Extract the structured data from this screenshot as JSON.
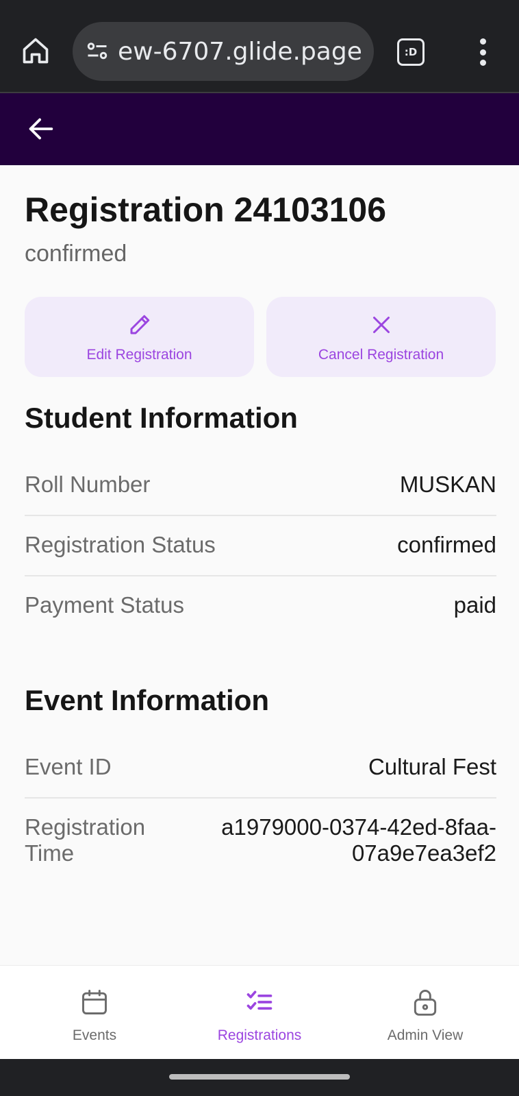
{
  "browser": {
    "url": "ew-6707.glide.page",
    "tab_label": ":D"
  },
  "page": {
    "title": "Registration 24103106",
    "status": "confirmed"
  },
  "actions": {
    "edit_label": "Edit Registration",
    "cancel_label": "Cancel Registration"
  },
  "student_section": {
    "title": "Student Information",
    "rows": [
      {
        "key": "Roll Number",
        "value": "MUSKAN"
      },
      {
        "key": "Registration Status",
        "value": "confirmed"
      },
      {
        "key": "Payment Status",
        "value": "paid"
      }
    ]
  },
  "event_section": {
    "title": "Event Information",
    "rows": [
      {
        "key": "Event ID",
        "value": "Cultural Fest"
      },
      {
        "key_line1": "Registration",
        "key_line2": "Time",
        "value_line1": "a1979000-0374-42ed-8faa-",
        "value_line2": "07a9e7ea3ef2"
      }
    ]
  },
  "nav": {
    "items": [
      {
        "label": "Events",
        "icon": "calendar-icon"
      },
      {
        "label": "Registrations",
        "icon": "checklist-icon"
      },
      {
        "label": "Admin View",
        "icon": "lock-icon"
      }
    ],
    "active": "Registrations"
  },
  "colors": {
    "header_bg": "#22003d",
    "accent": "#9b45e0",
    "button_bg": "#f1ebfa"
  }
}
